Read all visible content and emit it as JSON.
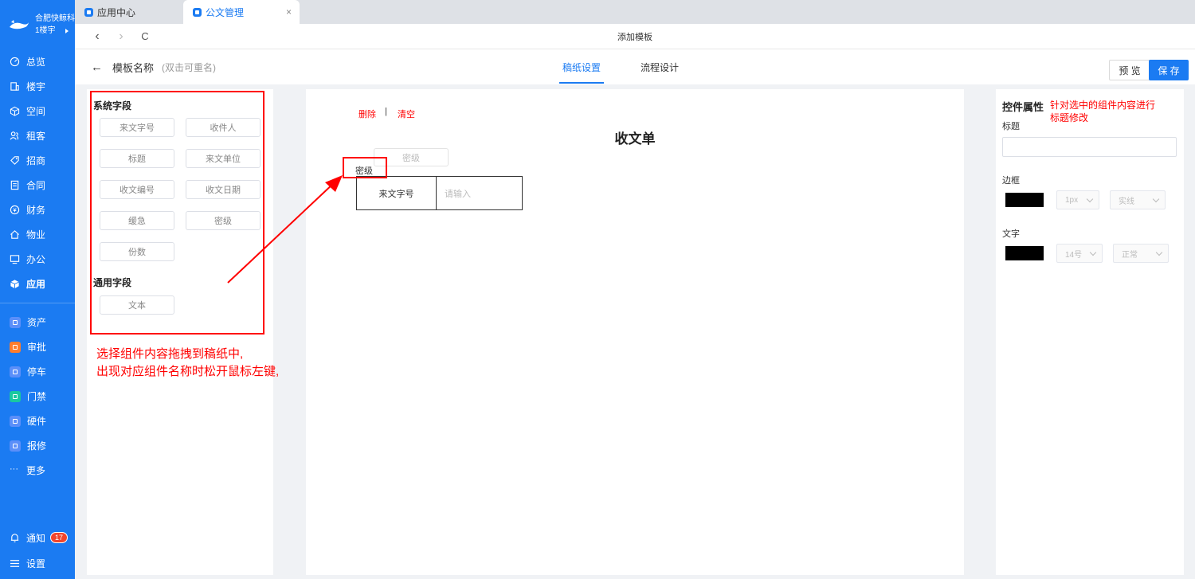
{
  "brand": {
    "name": "合肥快鲸科",
    "building": "1楼宇"
  },
  "nav": [
    {
      "label": "总览",
      "icon": "dashboard-icon"
    },
    {
      "label": "楼宇",
      "icon": "building-icon"
    },
    {
      "label": "空间",
      "icon": "cube-icon"
    },
    {
      "label": "租客",
      "icon": "users-icon"
    },
    {
      "label": "招商",
      "icon": "tag-icon"
    },
    {
      "label": "合同",
      "icon": "document-icon"
    },
    {
      "label": "财务",
      "icon": "coin-icon"
    },
    {
      "label": "物业",
      "icon": "home-icon"
    },
    {
      "label": "办公",
      "icon": "monitor-icon"
    },
    {
      "label": "应用",
      "icon": "app-cube-icon"
    }
  ],
  "apps": [
    {
      "label": "资产",
      "color": "#5b8ff9"
    },
    {
      "label": "审批",
      "color": "#ff7d2d"
    },
    {
      "label": "停车",
      "color": "#5b8ff9"
    },
    {
      "label": "门禁",
      "color": "#19c8a0"
    },
    {
      "label": "硬件",
      "color": "#5b8ff9"
    },
    {
      "label": "报修",
      "color": "#5b8ff9"
    }
  ],
  "more_label": "更多",
  "notify": {
    "label": "通知",
    "count": "17"
  },
  "settings_label": "设置",
  "tabs": [
    {
      "label": "应用中心"
    },
    {
      "label": "公文管理"
    }
  ],
  "tab_close": "×",
  "browser": {
    "back": "‹",
    "forward": "›",
    "reload": "C",
    "title": "添加模板"
  },
  "header": {
    "back_arrow": "←",
    "template_name": "模板名称",
    "rename_hint": "(双击可重名)",
    "tabs": [
      "稿纸设置",
      "流程设计"
    ],
    "preview": "预 览",
    "save": "保 存"
  },
  "left": {
    "system_title": "系统字段",
    "system_fields": [
      "来文字号",
      "收件人",
      "标题",
      "来文单位",
      "收文编号",
      "收文日期",
      "缓急",
      "密级",
      "份数"
    ],
    "common_title": "通用字段",
    "common_fields": [
      "文本"
    ],
    "annotation_line1": "选择组件内容拖拽到稿纸中,",
    "annotation_line2": "出现对应组件名称时松开鼠标左键,"
  },
  "center": {
    "delete": "删除",
    "separator": "|",
    "clear": "清空",
    "form_title": "收文单",
    "ghost_field": "密级",
    "drop_label": "密级",
    "row_label": "来文字号",
    "row_placeholder": "请输入"
  },
  "right": {
    "title": "控件属性",
    "annotation_line1": "针对选中的组件内容进行",
    "annotation_line2": "标题修改",
    "title_label": "标题",
    "border_label": "边框",
    "border_width": "1px",
    "border_style": "实线",
    "text_label": "文字",
    "font_size": "14号",
    "font_weight": "正常"
  },
  "colors": {
    "primary": "#1b7bf2",
    "annotation": "#ff0000",
    "badge": "#f2452c"
  }
}
